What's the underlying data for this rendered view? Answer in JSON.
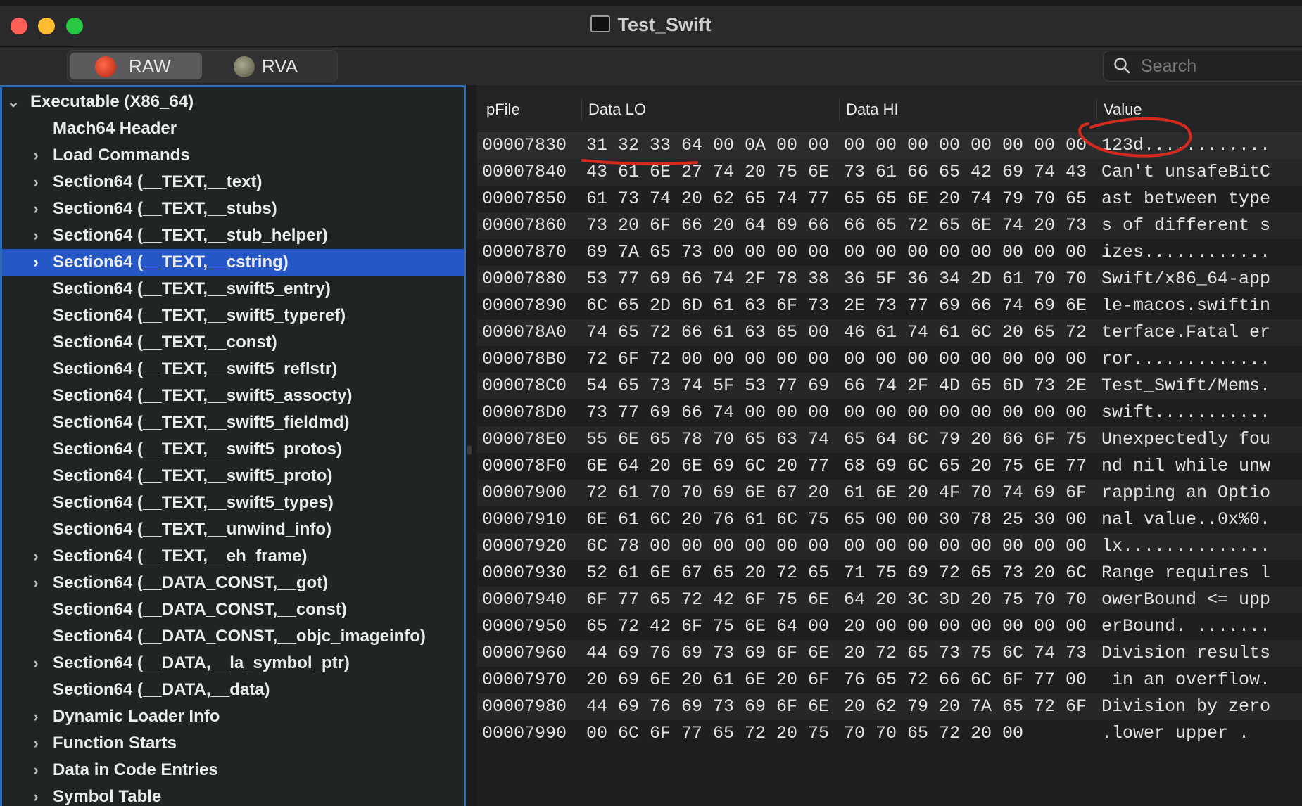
{
  "window": {
    "title": "Test_Swift"
  },
  "toolbar": {
    "segments": [
      {
        "label": "RAW",
        "selected": true
      },
      {
        "label": "RVA",
        "selected": false
      }
    ],
    "search_placeholder": "Search"
  },
  "sidebar": {
    "items": [
      {
        "label": "Executable  (X86_64)",
        "expander": "expanded",
        "level": 0
      },
      {
        "label": "Mach64 Header",
        "expander": "none",
        "level": 1
      },
      {
        "label": "Load Commands",
        "expander": "collapsed",
        "level": 1
      },
      {
        "label": "Section64 (__TEXT,__text)",
        "expander": "collapsed",
        "level": 1
      },
      {
        "label": "Section64 (__TEXT,__stubs)",
        "expander": "collapsed",
        "level": 1
      },
      {
        "label": "Section64 (__TEXT,__stub_helper)",
        "expander": "collapsed",
        "level": 1
      },
      {
        "label": "Section64 (__TEXT,__cstring)",
        "expander": "collapsed",
        "level": 1,
        "selected": true
      },
      {
        "label": "Section64 (__TEXT,__swift5_entry)",
        "expander": "none",
        "level": 1
      },
      {
        "label": "Section64 (__TEXT,__swift5_typeref)",
        "expander": "none",
        "level": 1
      },
      {
        "label": "Section64 (__TEXT,__const)",
        "expander": "none",
        "level": 1
      },
      {
        "label": "Section64 (__TEXT,__swift5_reflstr)",
        "expander": "none",
        "level": 1
      },
      {
        "label": "Section64 (__TEXT,__swift5_assocty)",
        "expander": "none",
        "level": 1
      },
      {
        "label": "Section64 (__TEXT,__swift5_fieldmd)",
        "expander": "none",
        "level": 1
      },
      {
        "label": "Section64 (__TEXT,__swift5_protos)",
        "expander": "none",
        "level": 1
      },
      {
        "label": "Section64 (__TEXT,__swift5_proto)",
        "expander": "none",
        "level": 1
      },
      {
        "label": "Section64 (__TEXT,__swift5_types)",
        "expander": "none",
        "level": 1
      },
      {
        "label": "Section64 (__TEXT,__unwind_info)",
        "expander": "none",
        "level": 1
      },
      {
        "label": "Section64 (__TEXT,__eh_frame)",
        "expander": "collapsed",
        "level": 1
      },
      {
        "label": "Section64 (__DATA_CONST,__got)",
        "expander": "collapsed",
        "level": 1
      },
      {
        "label": "Section64 (__DATA_CONST,__const)",
        "expander": "none",
        "level": 1
      },
      {
        "label": "Section64 (__DATA_CONST,__objc_imageinfo)",
        "expander": "none",
        "level": 1
      },
      {
        "label": "Section64 (__DATA,__la_symbol_ptr)",
        "expander": "collapsed",
        "level": 1
      },
      {
        "label": "Section64 (__DATA,__data)",
        "expander": "none",
        "level": 1
      },
      {
        "label": "Dynamic Loader Info",
        "expander": "collapsed",
        "level": 1
      },
      {
        "label": "Function Starts",
        "expander": "collapsed",
        "level": 1
      },
      {
        "label": "Data in Code Entries",
        "expander": "collapsed",
        "level": 1
      },
      {
        "label": "Symbol Table",
        "expander": "collapsed",
        "level": 1
      }
    ]
  },
  "table": {
    "headers": [
      "pFile",
      "Data LO",
      "Data HI",
      "Value"
    ],
    "rows": [
      [
        "00007830",
        "31 32 33 64 00 0A 00 00",
        "00 00 00 00 00 00 00 00",
        "123d............"
      ],
      [
        "00007840",
        "43 61 6E 27 74 20 75 6E",
        "73 61 66 65 42 69 74 43",
        "Can't unsafeBitC"
      ],
      [
        "00007850",
        "61 73 74 20 62 65 74 77",
        "65 65 6E 20 74 79 70 65",
        "ast between type"
      ],
      [
        "00007860",
        "73 20 6F 66 20 64 69 66",
        "66 65 72 65 6E 74 20 73",
        "s of different s"
      ],
      [
        "00007870",
        "69 7A 65 73 00 00 00 00",
        "00 00 00 00 00 00 00 00",
        "izes............"
      ],
      [
        "00007880",
        "53 77 69 66 74 2F 78 38",
        "36 5F 36 34 2D 61 70 70",
        "Swift/x86_64-app"
      ],
      [
        "00007890",
        "6C 65 2D 6D 61 63 6F 73",
        "2E 73 77 69 66 74 69 6E",
        "le-macos.swiftin"
      ],
      [
        "000078A0",
        "74 65 72 66 61 63 65 00",
        "46 61 74 61 6C 20 65 72",
        "terface.Fatal er"
      ],
      [
        "000078B0",
        "72 6F 72 00 00 00 00 00",
        "00 00 00 00 00 00 00 00",
        "ror............."
      ],
      [
        "000078C0",
        "54 65 73 74 5F 53 77 69",
        "66 74 2F 4D 65 6D 73 2E",
        "Test_Swift/Mems."
      ],
      [
        "000078D0",
        "73 77 69 66 74 00 00 00",
        "00 00 00 00 00 00 00 00",
        "swift..........."
      ],
      [
        "000078E0",
        "55 6E 65 78 70 65 63 74",
        "65 64 6C 79 20 66 6F 75",
        "Unexpectedly fou"
      ],
      [
        "000078F0",
        "6E 64 20 6E 69 6C 20 77",
        "68 69 6C 65 20 75 6E 77",
        "nd nil while unw"
      ],
      [
        "00007900",
        "72 61 70 70 69 6E 67 20",
        "61 6E 20 4F 70 74 69 6F",
        "rapping an Optio"
      ],
      [
        "00007910",
        "6E 61 6C 20 76 61 6C 75",
        "65 00 00 30 78 25 30 00",
        "nal value..0x%0."
      ],
      [
        "00007920",
        "6C 78 00 00 00 00 00 00",
        "00 00 00 00 00 00 00 00",
        "lx.............."
      ],
      [
        "00007930",
        "52 61 6E 67 65 20 72 65",
        "71 75 69 72 65 73 20 6C",
        "Range requires l"
      ],
      [
        "00007940",
        "6F 77 65 72 42 6F 75 6E",
        "64 20 3C 3D 20 75 70 70",
        "owerBound <= upp"
      ],
      [
        "00007950",
        "65 72 42 6F 75 6E 64 00",
        "20 00 00 00 00 00 00 00",
        "erBound. ......."
      ],
      [
        "00007960",
        "44 69 76 69 73 69 6F 6E",
        "20 72 65 73 75 6C 74 73",
        "Division results"
      ],
      [
        "00007970",
        "20 69 6E 20 61 6E 20 6F",
        "76 65 72 66 6C 6F 77 00",
        " in an overflow."
      ],
      [
        "00007980",
        "44 69 76 69 73 69 6F 6E",
        "20 62 79 20 7A 65 72 6F",
        "Division by zero"
      ],
      [
        "00007990",
        "00 6C 6F 77 65 72 20 75",
        "70 70 65 72 20 00",
        ".lower upper ."
      ]
    ]
  },
  "annotations": {
    "ink_color": "#d42a1e"
  }
}
